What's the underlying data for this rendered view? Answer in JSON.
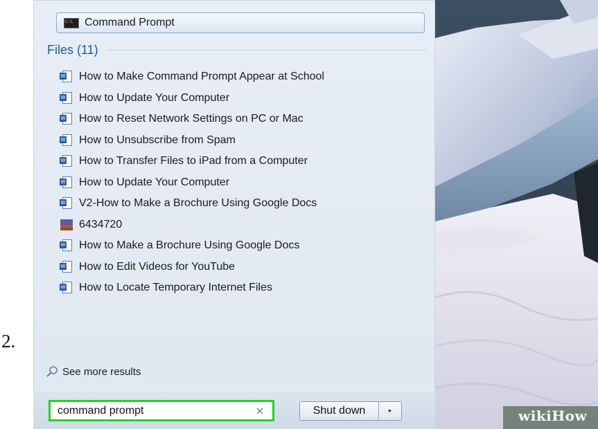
{
  "step_number": "2.",
  "top_result": {
    "label": "Command Prompt",
    "icon": "cmd-icon"
  },
  "files_section": {
    "title": "Files (11)",
    "items": [
      {
        "label": "How to Make Command Prompt Appear at School",
        "icon": "word-doc-icon"
      },
      {
        "label": "How to Update Your Computer",
        "icon": "word-doc-icon"
      },
      {
        "label": "How to Reset Network Settings on PC or Mac",
        "icon": "word-doc-icon"
      },
      {
        "label": "How to Unsubscribe from Spam",
        "icon": "word-doc-icon"
      },
      {
        "label": "How to Transfer Files to iPad from a Computer",
        "icon": "word-doc-icon"
      },
      {
        "label": "How to Update Your Computer",
        "icon": "word-doc-icon"
      },
      {
        "label": "V2-How to Make a Brochure Using Google Docs",
        "icon": "word-doc-icon"
      },
      {
        "label": "6434720",
        "icon": "rar-archive-icon"
      },
      {
        "label": "How to Make a Brochure Using Google Docs",
        "icon": "word-doc-icon"
      },
      {
        "label": "How to Edit Videos for YouTube",
        "icon": "word-doc-icon"
      },
      {
        "label": "How to Locate Temporary Internet Files",
        "icon": "word-doc-icon"
      }
    ]
  },
  "see_more": {
    "label": "See more results"
  },
  "search": {
    "value": "command prompt",
    "clear": "×"
  },
  "shutdown": {
    "label": "Shut down",
    "arrow": "▸"
  },
  "watermark": {
    "text": "wikiHow"
  },
  "colors": {
    "search_highlight": "#25d12a",
    "section_title": "#1f5a9a"
  }
}
